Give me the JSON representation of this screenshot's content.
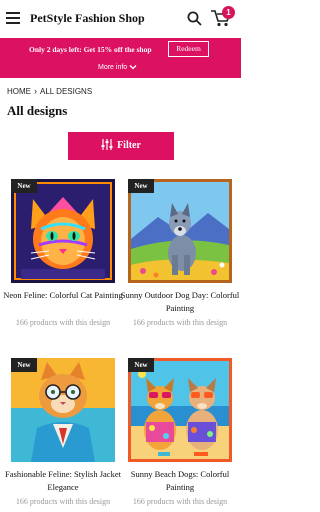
{
  "header": {
    "brand": "PetStyle Fashion Shop",
    "cart_count": "1"
  },
  "promo": {
    "text": "Only 2 days left: Get 15% off the shop",
    "redeem_label": "Redeem",
    "more_info_label": "More info"
  },
  "breadcrumb": {
    "home": "HOME",
    "separator": "›",
    "current": "ALL DESIGNS"
  },
  "page": {
    "title": "All designs",
    "filter_label": "Filter"
  },
  "colors": {
    "accent": "#dc1162",
    "badge": "#222222"
  },
  "products": [
    {
      "badge": "New",
      "title": "Neon Feline: Colorful Cat Painting",
      "subtitle": "166 products with this design"
    },
    {
      "badge": "New",
      "title": "Sunny Outdoor Dog Day: Colorful Painting",
      "subtitle": "166 products with this design"
    },
    {
      "badge": "New",
      "title": "Fashionable Feline: Stylish Jacket Elegance",
      "subtitle": "166 products with this design"
    },
    {
      "badge": "New",
      "title": "Sunny Beach Dogs: Colorful Painting",
      "subtitle": "166 products with this design"
    }
  ]
}
